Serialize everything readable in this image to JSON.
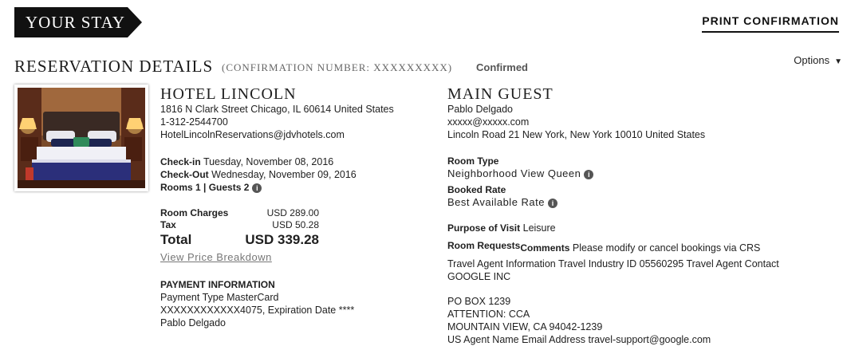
{
  "header": {
    "banner": "YOUR STAY",
    "print": "PRINT CONFIRMATION"
  },
  "reservation": {
    "title": "RESERVATION DETAILS",
    "confirmation_number": "(CONFIRMATION NUMBER: XXXXXXXXX)",
    "status": "Confirmed",
    "options": "Options"
  },
  "hotel": {
    "name": "HOTEL LINCOLN",
    "address": "1816 N Clark Street Chicago, IL 60614 United States",
    "phone": "1-312-2544700",
    "email": "HotelLincolnReservations@jdvhotels.com",
    "checkin_label": "Check-in",
    "checkin_value": "Tuesday, November 08, 2016",
    "checkout_label": "Check-Out",
    "checkout_value": "Wednesday, November 09, 2016",
    "rooms_guests": "Rooms 1 | Guests 2"
  },
  "charges": {
    "room_label": "Room Charges",
    "room_value": "USD 289.00",
    "tax_label": "Tax",
    "tax_value": "USD 50.28",
    "total_label": "Total",
    "total_value": "USD 339.28",
    "breakdown": "View Price Breakdown"
  },
  "payment": {
    "title": "PAYMENT INFORMATION",
    "type": "Payment Type MasterCard",
    "card": "XXXXXXXXXXXX4075, Expiration Date ****",
    "name": "Pablo Delgado"
  },
  "guest": {
    "title": "MAIN GUEST",
    "name": "Pablo Delgado",
    "email": "xxxxx@xxxxx.com",
    "address": "Lincoln Road 21 New York, New York 10010 United States",
    "room_type_label": "Room Type",
    "room_type": "Neighborhood View Queen",
    "rate_label": "Booked Rate",
    "rate": "Best Available Rate",
    "purpose_label": "Purpose of Visit",
    "purpose": "Leisure",
    "requests_label": "Room Requests",
    "comments_label": "Comments",
    "comments": "Please modify or cancel bookings via CRS",
    "agent_line1": "Travel Agent Information Travel Industry ID 05560295 Travel Agent Contact",
    "agent_line2": "GOOGLE INC",
    "po_box": "PO BOX 1239",
    "attention": "ATTENTION: CCA",
    "city": "MOUNTAIN VIEW, CA 94042-1239",
    "us_agent": "US Agent Name Email Address travel-support@google.com"
  },
  "colors": {
    "banner_bg": "#111111",
    "text": "#1f1f1f",
    "muted": "#777777"
  }
}
